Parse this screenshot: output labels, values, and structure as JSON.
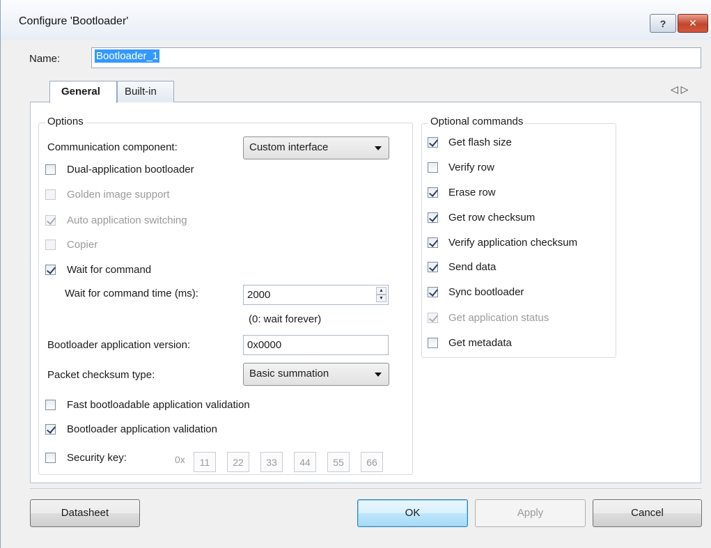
{
  "window": {
    "title": "Configure 'Bootloader'",
    "help_label": "?",
    "close_label": "✕"
  },
  "name": {
    "label": "Name:",
    "value": "Bootloader_1"
  },
  "tabs": [
    {
      "label": "General"
    },
    {
      "label": "Built-in"
    }
  ],
  "tab_scroll": {
    "left": "◁",
    "right": "▷"
  },
  "options": {
    "legend": "Options",
    "comm_label": "Communication component:",
    "comm_value": "Custom interface",
    "dual_app": "Dual-application bootloader",
    "golden_image": "Golden image support",
    "auto_switch": "Auto application switching",
    "copier": "Copier",
    "wait_cmd": "Wait for command",
    "wait_time_label": "Wait for command time (ms):",
    "wait_time_value": "2000",
    "wait_hint": "(0: wait forever)",
    "app_version_label": "Bootloader application version:",
    "app_version_value": "0x0000",
    "checksum_label": "Packet checksum type:",
    "checksum_value": "Basic summation",
    "fast_validation": "Fast bootloadable application validation",
    "app_validation": "Bootloader application validation",
    "security_key": "Security key:",
    "key_prefix": "0x",
    "key_bytes": [
      "11",
      "22",
      "33",
      "44",
      "55",
      "66"
    ]
  },
  "optional": {
    "legend": "Optional commands",
    "items": [
      "Get flash size",
      "Verify row",
      "Erase row",
      "Get row checksum",
      "Verify application checksum",
      "Send data",
      "Sync bootloader",
      "Get application status",
      "Get metadata"
    ]
  },
  "buttons": {
    "datasheet": "Datasheet",
    "ok": "OK",
    "apply": "Apply",
    "cancel": "Cancel"
  }
}
